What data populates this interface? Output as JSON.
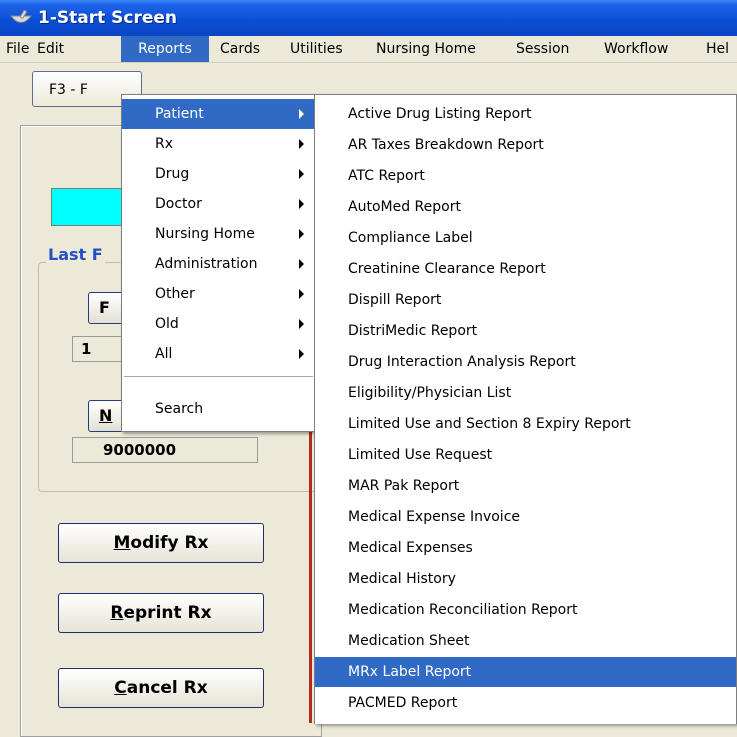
{
  "window": {
    "title": "1-Start Screen"
  },
  "menubar": {
    "items": [
      "File",
      "Edit",
      "Reports",
      "Cards",
      "Utilities",
      "Nursing Home",
      "Session",
      "Workflow",
      "Hel"
    ],
    "open": "Reports"
  },
  "toolbar": {
    "f3_label": "F3 - F"
  },
  "left_panel": {
    "group_label": "Last F",
    "button_top": "F",
    "field_top": "1",
    "button_n": "N",
    "field_number": "9000000",
    "modify_hot": "M",
    "modify_rest": "odify Rx",
    "reprint_hot": "R",
    "reprint_rest": "eprint Rx",
    "cancel_hot": "C",
    "cancel_rest": "ancel Rx"
  },
  "reports_menu": {
    "items": [
      {
        "label": "Patient",
        "submenu": true,
        "selected": true
      },
      {
        "label": "Rx",
        "submenu": true
      },
      {
        "label": "Drug",
        "submenu": true
      },
      {
        "label": "Doctor",
        "submenu": true
      },
      {
        "label": "Nursing Home",
        "submenu": true
      },
      {
        "label": "Administration",
        "submenu": true
      },
      {
        "label": "Other",
        "submenu": true
      },
      {
        "label": "Old",
        "submenu": true
      },
      {
        "label": "All",
        "submenu": true
      },
      {
        "label": "Search",
        "submenu": false
      }
    ]
  },
  "patient_submenu": {
    "items": [
      "Active Drug Listing Report",
      "AR Taxes Breakdown Report",
      "ATC Report",
      "AutoMed Report",
      "Compliance Label",
      "Creatinine Clearance Report",
      "Dispill Report",
      "DistriMedic Report",
      "Drug Interaction Analysis Report",
      "Eligibility/Physician List",
      "Limited Use and Section 8 Expiry Report",
      "Limited Use Request",
      "MAR Pak Report",
      "Medical Expense Invoice",
      "Medical Expenses",
      "Medical History",
      "Medication Reconciliation Report",
      "Medication Sheet",
      "MRx Label Report",
      "PACMED Report"
    ],
    "selected": "MRx Label Report"
  },
  "colors": {
    "titlebar": "#0b4fd6",
    "highlight": "#316ac5",
    "cyan_box": "#00ffff",
    "group_label": "#2150c8"
  }
}
